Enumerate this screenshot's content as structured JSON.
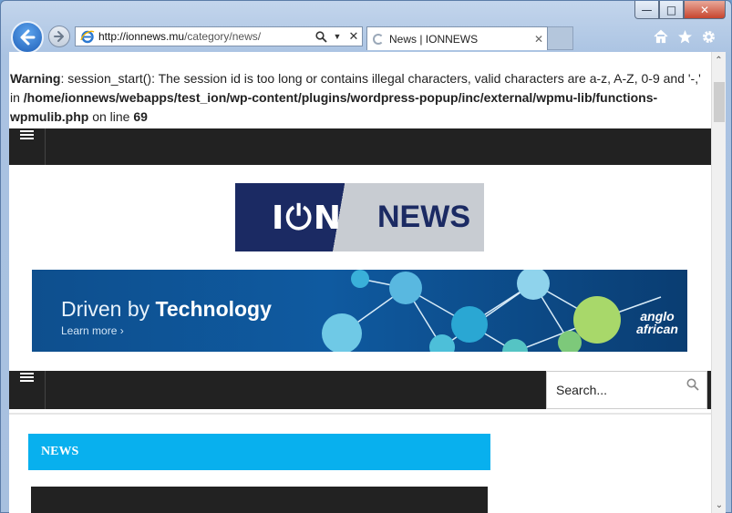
{
  "browser": {
    "url_host": "http://ionnews.mu",
    "url_path": "/category/news/",
    "tab_title": "News | IONNEWS"
  },
  "warning": {
    "label": "Warning",
    "message": ": session_start(): The session id is too long or contains illegal characters, valid characters are a-z, A-Z, 0-9 and '-,' in ",
    "path": "/home/ionnews/webapps/test_ion/wp-content/plugins/wordpress-popup/inc/external/wpmu-lib/functions-wpmulib.php",
    "line_text": " on line ",
    "line_number": "69"
  },
  "logo": {
    "part1": "I⏻N",
    "part2": "NEWS"
  },
  "banner": {
    "title_light": "Driven by ",
    "title_bold": "Technology",
    "sub": "Learn more  ›",
    "brand_line1": "anglo",
    "brand_line2": "african"
  },
  "search": {
    "placeholder": "Search..."
  },
  "section": {
    "title": "NEWS"
  },
  "colors": {
    "accent": "#08b0ee",
    "navbar": "#222222",
    "logo_dark": "#1b2a63"
  }
}
